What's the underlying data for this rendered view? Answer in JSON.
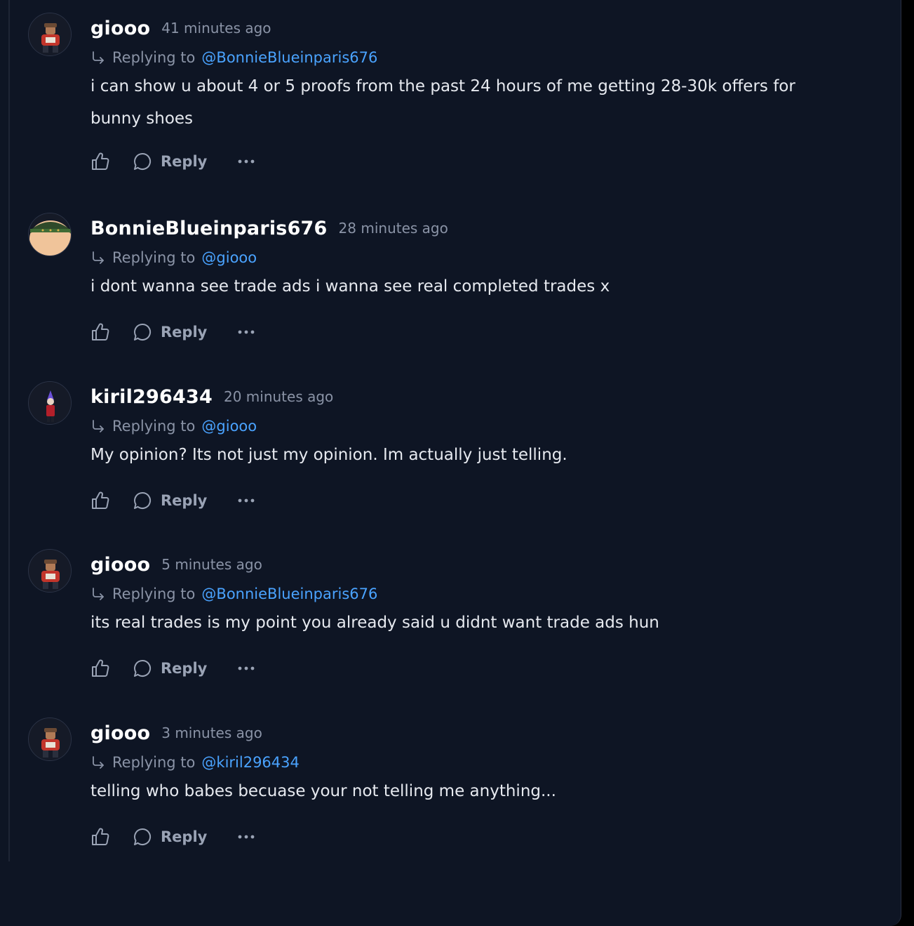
{
  "colors": {
    "background": "#0e1524",
    "username": "#ffffff",
    "muted": "#8a93a6",
    "mention": "#4aa3ff",
    "text": "#e6e9ef",
    "action": "#9aa3b5"
  },
  "ui": {
    "replying_label": "Replying to",
    "reply_label": "Reply",
    "like_icon": "thumbs-up-icon",
    "reply_icon": "chat-bubble-icon",
    "more_icon": "ellipsis-icon",
    "reply_arrow_icon": "reply-arrow-icon"
  },
  "comments": [
    {
      "username": "giooo",
      "time": "41 minutes ago",
      "replying_to": "@BonnieBlueinparis676",
      "text": "i can show u about 4 or 5 proofs from the past 24 hours of me getting 28-30k offers for bunny shoes",
      "avatar": "avatar-giooo"
    },
    {
      "username": "BonnieBlueinparis676",
      "time": "28 minutes ago",
      "replying_to": "@giooo",
      "text": "i dont wanna see trade ads i wanna see real completed trades x",
      "avatar": "avatar-bonnie"
    },
    {
      "username": "kiril296434",
      "time": "20 minutes ago",
      "replying_to": "@giooo",
      "text": "My opinion? Its not just my opinion. Im actually just telling.",
      "avatar": "avatar-kiril"
    },
    {
      "username": "giooo",
      "time": "5 minutes ago",
      "replying_to": "@BonnieBlueinparis676",
      "text": "its real trades is my point you already said u didnt want trade ads hun",
      "avatar": "avatar-giooo"
    },
    {
      "username": "giooo",
      "time": "3 minutes ago",
      "replying_to": "@kiril296434",
      "text": "telling who babes becuase your not telling me anything...",
      "avatar": "avatar-giooo"
    }
  ]
}
